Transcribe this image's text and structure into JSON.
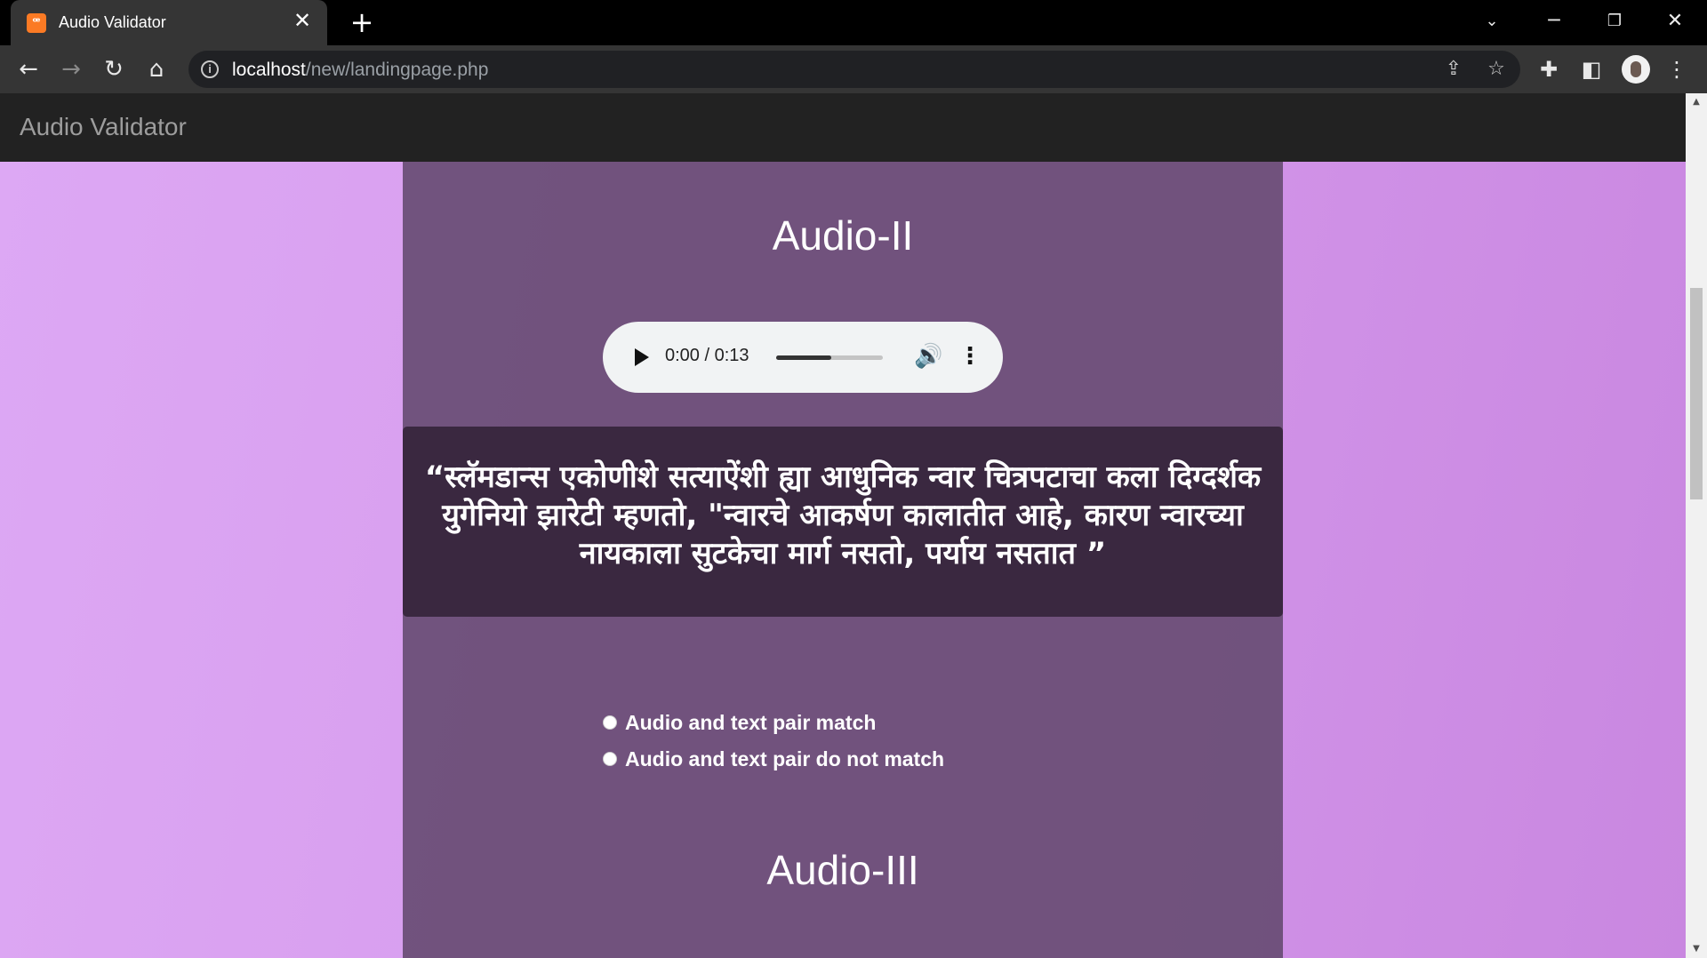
{
  "browser": {
    "tab_title": "Audio Validator",
    "favicon": "xampp-icon",
    "url_host": "localhost",
    "url_path": "/new/landingpage.php"
  },
  "page": {
    "brand": "Audio Validator",
    "current": {
      "heading": "Audio-II",
      "player": {
        "time": "0:00 / 0:13",
        "progress_fraction": 0.52
      },
      "transcript": "“स्लॅमडान्स एकोणीशे सत्याऐंशी ह्या आधुनिक न्वार चित्रपटाचा कला दिग्दर्शक युगेनियो झारेटी म्हणतो, \"न्वारचे आकर्षण कालातीत आहे, कारण न्वारच्या नायकाला सुटकेचा मार्ग नसतो, पर्याय नसतात ”",
      "options": [
        "Audio and text pair match",
        "Audio and text pair do not match"
      ]
    },
    "next": {
      "heading": "Audio-III"
    }
  },
  "colors": {
    "page_bg": "#d79dee",
    "panel_bg": "#6a4e76",
    "quote_bg": "#3a2840",
    "navbar_bg": "#222222"
  }
}
